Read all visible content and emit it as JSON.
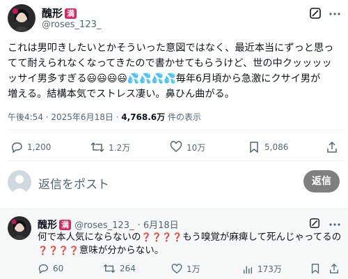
{
  "main_tweet": {
    "author_name": "醜形",
    "author_badge": "満",
    "author_handle": "@roses_123_",
    "text_line1": "これは男叩きしたいとかそういった意図ではなく、最近本当にずっと思っ",
    "text_line2": "てて耐えられなくなってきたので書かせてもらうけど、世の中クッッッッ",
    "text_line3a": "ッサイ男多すぎる",
    "text_emojis": "😃😃😃😃💦💦💦💦",
    "text_line3b": "毎年6月頃から急激にクサイ男が",
    "text_line4": "増える。結構本気でストレス凄い。鼻ひん曲がる。",
    "timestamp": "午後4:54 · 2025年6月18日 · ",
    "views_count": "4,768.6万",
    "views_label": "件の表示",
    "actions": {
      "replies": "1,200",
      "reposts": "1.2万",
      "likes": "10万",
      "bookmarks": "5,086"
    }
  },
  "reply_composer": {
    "placeholder": "返信をポスト",
    "button_label": "返信"
  },
  "reply_tweet": {
    "author_name": "醜形",
    "author_badge": "満",
    "author_handle": "@roses_123_",
    "date": "· 6月18日",
    "text_line1a": "何で本人気にならないの",
    "text_marks1": "❓❓❓❓",
    "text_line1b": "もう嗅覚が麻痺して死んじゃってるの",
    "text_marks2": "❓❓❓❓",
    "text_line2b": "意味が分からない。",
    "actions": {
      "replies": "60",
      "reposts": "264",
      "likes": "1万",
      "views": "173万"
    }
  },
  "colors": {
    "badge": "#e0245e",
    "muted": "#536471",
    "reply_button": "#7f7f7f"
  }
}
